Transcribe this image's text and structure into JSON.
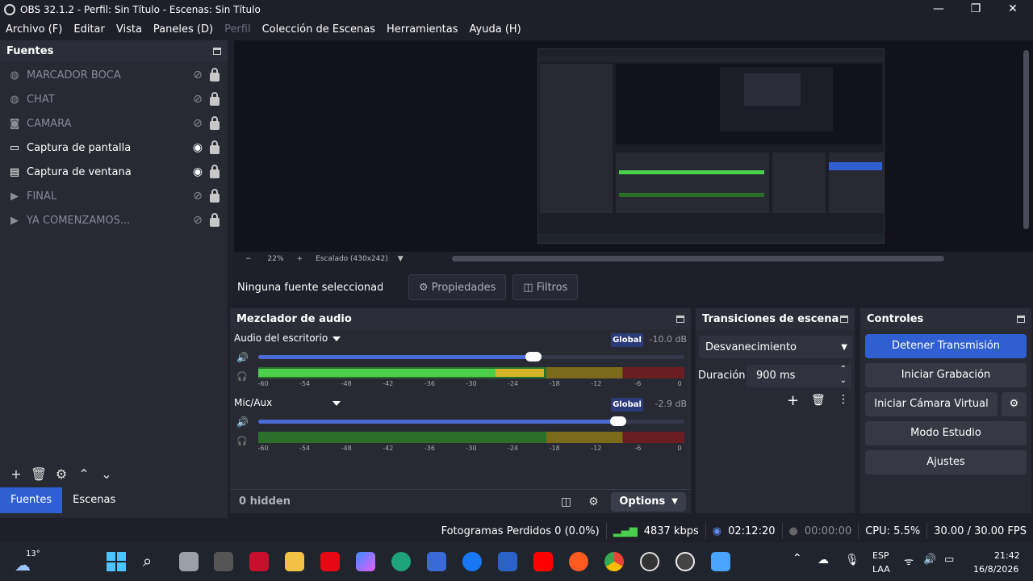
{
  "window": {
    "title": "OBS 32.1.2 - Perfil: Sin Título - Escenas: Sin Título",
    "controls": {
      "minimize": "—",
      "maximize": "❐",
      "close": "✕"
    }
  },
  "menu": [
    "Archivo (F)",
    "Editar",
    "Vista",
    "Paneles (D)",
    "Perfil",
    "Colección de Escenas",
    "Herramientas",
    "Ayuda (H)"
  ],
  "sources": {
    "title": "Fuentes",
    "items": [
      {
        "label": "MARCADOR BOCA",
        "icon": "globe-icon",
        "visible": false
      },
      {
        "label": "CHAT",
        "icon": "globe-icon",
        "visible": false
      },
      {
        "label": "CAMARA",
        "icon": "camera-icon",
        "visible": false
      },
      {
        "label": "Captura de pantalla",
        "icon": "monitor-icon",
        "visible": true
      },
      {
        "label": "Captura de ventana",
        "icon": "window-icon",
        "visible": true
      },
      {
        "label": "FINAL",
        "icon": "play-icon",
        "visible": false
      },
      {
        "label": "YA COMENZAMOS...",
        "icon": "play-icon",
        "visible": false
      }
    ],
    "tabs": [
      "Fuentes",
      "Escenas"
    ]
  },
  "preview": {
    "zoom": "22%",
    "scale_label": "Escalado (430x242)",
    "zoom_out": "−",
    "zoom_in": "+"
  },
  "context": {
    "selection": "Ninguna fuente seleccionad",
    "properties": "Propiedades",
    "filters": "Filtros"
  },
  "mixer": {
    "title": "Mezclador de audio",
    "channels": [
      {
        "name": "Audio del escritorio",
        "badge": "Global",
        "db": "-10.0 dB",
        "volume": 0.645,
        "level": 0.67
      },
      {
        "name": "Mic/Aux",
        "badge": "Global",
        "db": "-2.9 dB",
        "volume": 0.845,
        "level": 0.0
      }
    ],
    "ticks": [
      "-60",
      "-54",
      "-48",
      "-42",
      "-36",
      "-30",
      "-24",
      "-18",
      "-12",
      "-6",
      "0"
    ],
    "hidden": "0 hidden",
    "options": "Options"
  },
  "transitions": {
    "title": "Transiciones de escena",
    "selected": "Desvanecimiento",
    "duration_label": "Duración",
    "duration": "900 ms"
  },
  "controls": {
    "title": "Controles",
    "stop_stream": "Detener Transmisión",
    "start_recording": "Iniciar Grabación",
    "start_virtual_cam": "Iniciar Cámara Virtual",
    "studio_mode": "Modo Estudio",
    "settings": "Ajustes"
  },
  "status": {
    "dropped": "Fotogramas Perdidos 0 (0.0%)",
    "bitrate": "4837 kbps",
    "stream_time": "02:12:20",
    "rec_time": "00:00:00",
    "cpu": "CPU: 5.5%",
    "fps": "30.00 / 30.00 FPS"
  },
  "taskbar": {
    "weather": "13°",
    "lang1": "ESP",
    "lang2": "LAA",
    "time": "21:42",
    "date": "16/8/2026"
  }
}
